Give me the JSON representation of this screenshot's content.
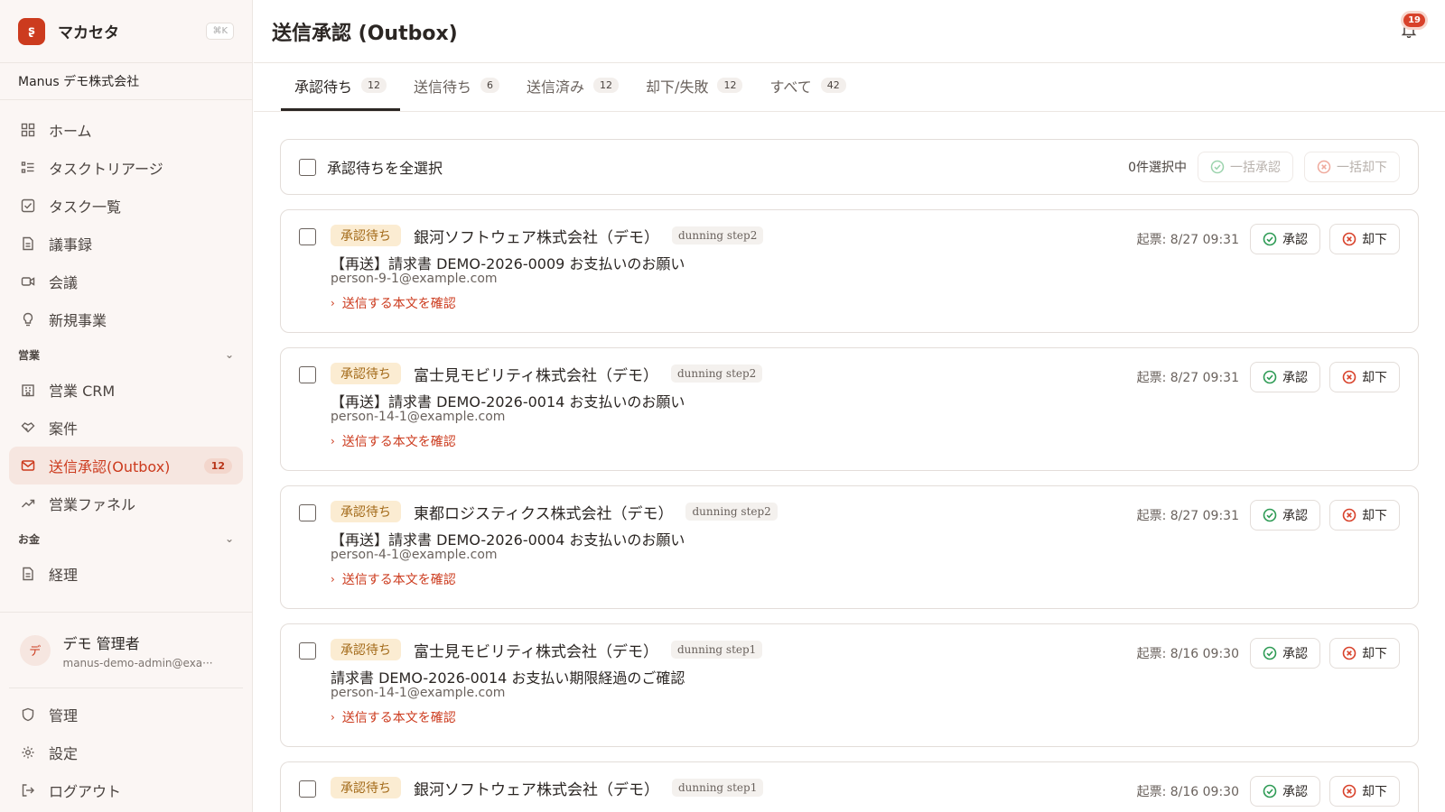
{
  "brand": {
    "logo": "ʂ",
    "name": "マカセタ",
    "shortcut": "⌘K"
  },
  "org": {
    "name": "Manus デモ株式会社"
  },
  "nav": {
    "home": "ホーム",
    "triage": "タスクトリアージ",
    "tasks": "タスク一覧",
    "minutes": "議事録",
    "meetings": "会議",
    "new_business": "新規事業",
    "sales_section": "営業",
    "crm": "営業 CRM",
    "deals": "案件",
    "outbox": "送信承認(Outbox)",
    "outbox_count": "12",
    "funnel": "営業ファネル",
    "money_section": "お金",
    "accounting": "経理"
  },
  "user": {
    "avatar": "デ",
    "name": "デモ 管理者",
    "email": "manus-demo-admin@exa···"
  },
  "bottom_nav": {
    "admin": "管理",
    "settings": "設定",
    "logout": "ログアウト"
  },
  "header": {
    "title": "送信承認 (Outbox)",
    "notification_count": "19"
  },
  "tabs": [
    {
      "label": "承認待ち",
      "count": "12"
    },
    {
      "label": "送信待ち",
      "count": "6"
    },
    {
      "label": "送信済み",
      "count": "12"
    },
    {
      "label": "却下/失敗",
      "count": "12"
    },
    {
      "label": "すべて",
      "count": "42"
    }
  ],
  "bulk": {
    "select_all": "承認待ちを全選択",
    "selected": "0件選択中",
    "approve_all": "一括承認",
    "reject_all": "一括却下"
  },
  "actions": {
    "approve": "承認",
    "reject": "却下",
    "preview": "送信する本文を確認"
  },
  "messages": [
    {
      "status": "承認待ち",
      "company": "銀河ソフトウェア株式会社（デモ）",
      "step": "dunning step2",
      "subject": "【再送】請求書 DEMO-2026-0009 お支払いのお願い",
      "email": "person-9-1@example.com",
      "created": "起票: 8/27 09:31"
    },
    {
      "status": "承認待ち",
      "company": "富士見モビリティ株式会社（デモ）",
      "step": "dunning step2",
      "subject": "【再送】請求書 DEMO-2026-0014 お支払いのお願い",
      "email": "person-14-1@example.com",
      "created": "起票: 8/27 09:31"
    },
    {
      "status": "承認待ち",
      "company": "東都ロジスティクス株式会社（デモ）",
      "step": "dunning step2",
      "subject": "【再送】請求書 DEMO-2026-0004 お支払いのお願い",
      "email": "person-4-1@example.com",
      "created": "起票: 8/27 09:31"
    },
    {
      "status": "承認待ち",
      "company": "富士見モビリティ株式会社（デモ）",
      "step": "dunning step1",
      "subject": "請求書 DEMO-2026-0014 お支払い期限経過のご確認",
      "email": "person-14-1@example.com",
      "created": "起票: 8/16 09:30"
    },
    {
      "status": "承認待ち",
      "company": "銀河ソフトウェア株式会社（デモ）",
      "step": "dunning step1",
      "created": "起票: 8/16 09:30"
    }
  ],
  "colors": {
    "accent": "#cc3b1e",
    "approve": "#2e9b55",
    "reject": "#d8412a",
    "pending_bg": "#fbecd2"
  }
}
